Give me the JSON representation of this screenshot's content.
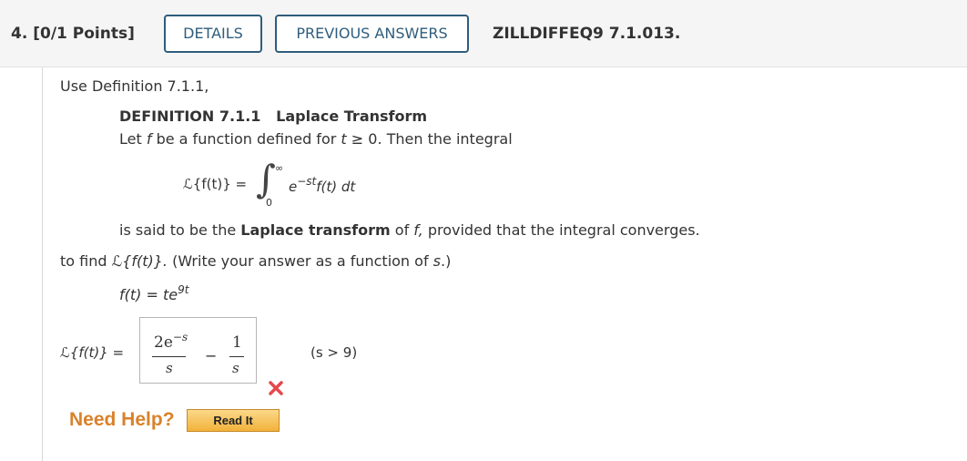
{
  "header": {
    "question_number": "4.",
    "points": "[0/1 Points]",
    "details_label": "DETAILS",
    "previous_answers_label": "PREVIOUS ANSWERS",
    "question_code": "ZILLDIFFEQ9 7.1.013."
  },
  "body": {
    "intro": "Use Definition 7.1.1,",
    "definition_number": "DEFINITION 7.1.1",
    "definition_name": "Laplace Transform",
    "def_line_1": "Let",
    "def_f": "f",
    "def_line_2": "be a function defined for",
    "def_t": "t",
    "def_line_3": "≥ 0. Then the integral",
    "formula_lhs": "ℒ{f(t)} =",
    "integral_sign": "∫",
    "integral_upper": "∞",
    "integral_lower": "0",
    "integrand_base": "e",
    "integrand_exp": "−st",
    "integrand_rest": "f(t) dt",
    "said_1": "is said to be the",
    "said_bold": "Laplace transform",
    "said_2": "of",
    "said_f": "f,",
    "said_3": "provided that the integral converges.",
    "find_1": "to find",
    "find_L": "ℒ{f(t)}.",
    "find_2": "(Write your answer as a function of",
    "find_s": "s",
    "find_3": ".)",
    "given_lhs": "f(t) =",
    "given_base": "te",
    "given_exp": "9t"
  },
  "answer": {
    "lhs": "ℒ{f(t)} =",
    "num1": "2e",
    "num1_exp": "−s",
    "den1": "s",
    "minus": "−",
    "num2": "1",
    "den2": "s",
    "condition": "(s > 9)",
    "status_icon": "incorrect-x-icon",
    "status_color": "#e5484d"
  },
  "help": {
    "need_help": "Need Help?",
    "read_it": "Read It"
  }
}
